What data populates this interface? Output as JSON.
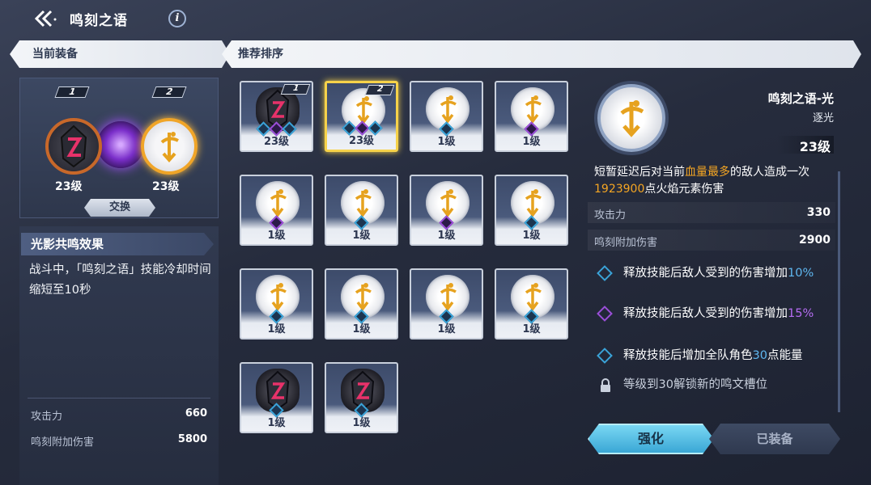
{
  "header": {
    "title": "鸣刻之语",
    "info_icon": "info-icon"
  },
  "banners": {
    "current": "当前装备",
    "recommend": "推荐排序"
  },
  "current_equip": {
    "slot1_badge": "1",
    "slot2_badge": "2",
    "slot1_level": "23级",
    "slot2_level": "23级",
    "swap_label": "交换"
  },
  "resonance": {
    "title": "光影共鸣效果",
    "desc": "战斗中，「鸣刻之语」技能冷却时间缩短至10秒"
  },
  "left_stats": [
    {
      "label": "攻击力",
      "value": "660"
    },
    {
      "label": "鸣刻附加伤害",
      "value": "5800"
    }
  ],
  "cards": [
    {
      "level": "23级",
      "type": "dark",
      "badge": "1",
      "gems": [
        "blue",
        "purple",
        "blue"
      ]
    },
    {
      "level": "23级",
      "type": "light",
      "badge": "2",
      "gems": [
        "blue",
        "purple",
        "blue"
      ],
      "selected": true
    },
    {
      "level": "1级",
      "type": "light",
      "gems": [
        "blue"
      ]
    },
    {
      "level": "1级",
      "type": "light",
      "gems": [
        "purple"
      ]
    },
    {
      "level": "1级",
      "type": "light",
      "gems": [
        "purple"
      ]
    },
    {
      "level": "1级",
      "type": "light",
      "gems": [
        "blue"
      ]
    },
    {
      "level": "1级",
      "type": "light",
      "gems": [
        "purple"
      ]
    },
    {
      "level": "1级",
      "type": "light",
      "gems": [
        "blue"
      ]
    },
    {
      "level": "1级",
      "type": "light",
      "gems": [
        "blue"
      ]
    },
    {
      "level": "1级",
      "type": "light",
      "gems": [
        "blue"
      ]
    },
    {
      "level": "1级",
      "type": "light",
      "gems": [
        "blue"
      ]
    },
    {
      "level": "1级",
      "type": "light",
      "gems": [
        "blue"
      ]
    },
    {
      "level": "1级",
      "type": "dark",
      "gems": [
        "blue"
      ]
    },
    {
      "level": "1级",
      "type": "dark",
      "gems": [
        "blue"
      ]
    }
  ],
  "detail": {
    "name": "鸣刻之语-光",
    "subtitle": "逐光",
    "level": "23级",
    "desc_parts": {
      "a": "短暂延迟后对当前",
      "b": "血量最多",
      "c": "的敌人造成一次",
      "d": "1923900",
      "e": "点火焰元素伤害"
    },
    "stats": [
      {
        "label": "攻击力",
        "value": "330"
      },
      {
        "label": "鸣刻附加伤害",
        "value": "2900"
      }
    ],
    "effects": [
      {
        "icon": "blue",
        "pre": "释放技能后敌人受到的伤害增加",
        "num": "10",
        "post": "%"
      },
      {
        "icon": "purple",
        "pre": "释放技能后敌人受到的伤害增加",
        "num": "15",
        "post": "%"
      },
      {
        "icon": "blue",
        "pre": "释放技能后增加全队角色",
        "num": "30",
        "post": "点能量"
      }
    ],
    "locked_note": "等级到30解锁新的鸣文槽位",
    "strengthen_label": "强化",
    "equipped_label": "已装备"
  },
  "colors": {
    "accent": "#f5a623",
    "blue": "#5fb7f0",
    "purple": "#b56cf2",
    "selected_border": "#f6d24a"
  }
}
